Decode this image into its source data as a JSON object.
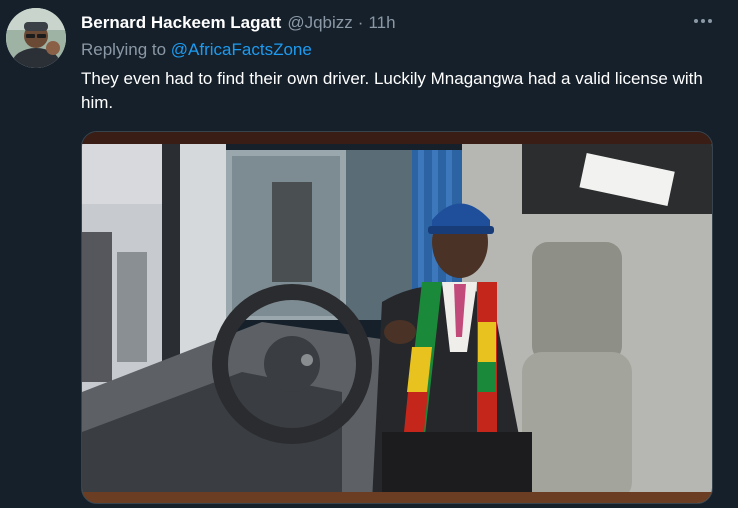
{
  "tweet": {
    "display_name": "Bernard Hackeem Lagatt",
    "handle": "@Jqbizz",
    "separator": "·",
    "time": "11h",
    "replying_prefix": "Replying to",
    "replying_to": "@AfricaFactsZone",
    "text": "They even had to find their own driver. Luckily Mnagangwa had a valid license with him."
  },
  "icons": {
    "more": "more-options-icon",
    "avatar": "profile-avatar"
  },
  "colors": {
    "background": "#15202b",
    "primary_text": "#ffffff",
    "secondary_text": "#8b98a5",
    "link": "#1d9bf0"
  }
}
